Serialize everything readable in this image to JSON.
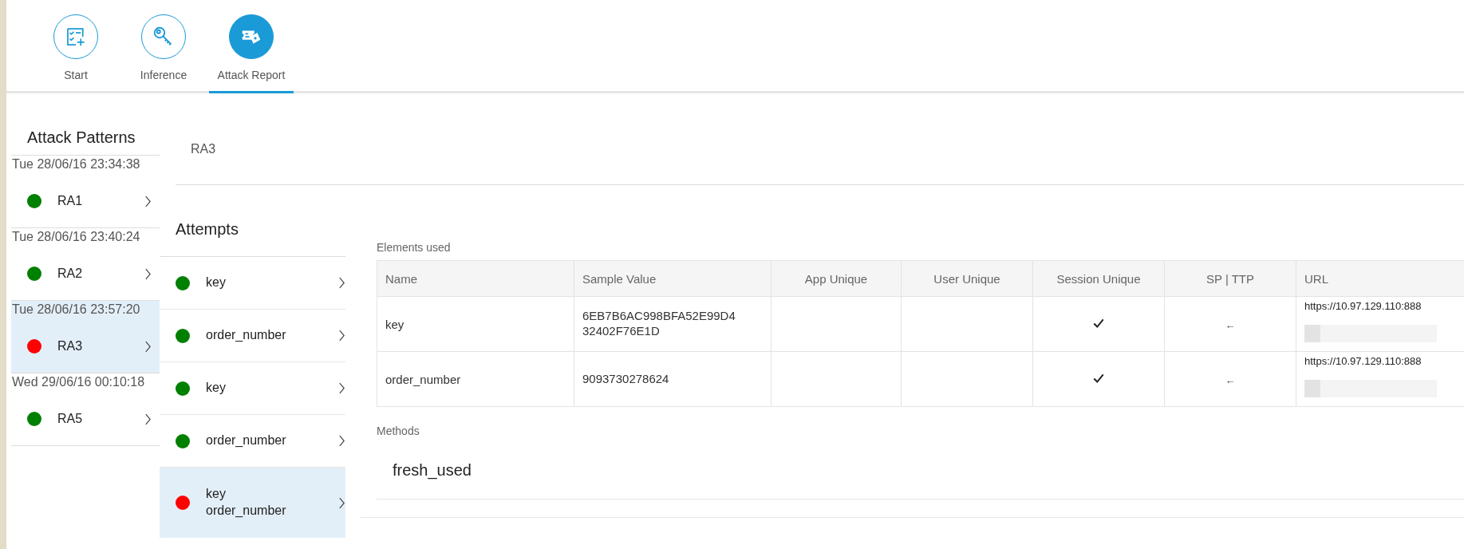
{
  "nav_tabs": [
    {
      "label": "Start",
      "selected": false
    },
    {
      "label": "Inference",
      "selected": false
    },
    {
      "label": "Attack Report",
      "selected": true
    }
  ],
  "attack_patterns": {
    "title": "Attack Patterns",
    "items": [
      {
        "date": "Tue 28/06/16 23:34:38",
        "name": "RA1",
        "color": "#008000",
        "selected": false
      },
      {
        "date": "Tue 28/06/16 23:40:24",
        "name": "RA2",
        "color": "#008000",
        "selected": false
      },
      {
        "date": "Tue 28/06/16 23:57:20",
        "name": "RA3",
        "color": "#ff0000",
        "selected": true
      },
      {
        "date": "Wed 29/06/16 00:10:18",
        "name": "RA5",
        "color": "#008000",
        "selected": false
      }
    ]
  },
  "detail_title": "RA3",
  "attempts": {
    "title": "Attempts",
    "items": [
      {
        "lines": [
          "key"
        ],
        "color": "#008000",
        "selected": false
      },
      {
        "lines": [
          "order_number"
        ],
        "color": "#008000",
        "selected": false
      },
      {
        "lines": [
          "key"
        ],
        "color": "#008000",
        "selected": false
      },
      {
        "lines": [
          "order_number"
        ],
        "color": "#008000",
        "selected": false
      },
      {
        "lines": [
          "key",
          "order_number"
        ],
        "color": "#ff0000",
        "selected": true
      }
    ]
  },
  "elements_used": {
    "label": "Elements used",
    "columns": [
      "Name",
      "Sample Value",
      "App Unique",
      "User Unique",
      "Session Unique",
      "SP | TTP",
      "URL"
    ],
    "rows": [
      {
        "name": "key",
        "sample_value": [
          "6EB7B6AC998BFA52E99D4",
          "32402F76E1D"
        ],
        "app_unique": false,
        "user_unique": false,
        "session_unique": true,
        "sp_ttp": "←",
        "url": "https://10.97.129.110:888"
      },
      {
        "name": "order_number",
        "sample_value": [
          "9093730278624"
        ],
        "app_unique": false,
        "user_unique": false,
        "session_unique": true,
        "sp_ttp": "←",
        "url": "https://10.97.129.110:888"
      }
    ]
  },
  "methods": {
    "label": "Methods",
    "items": [
      "fresh_used"
    ]
  }
}
